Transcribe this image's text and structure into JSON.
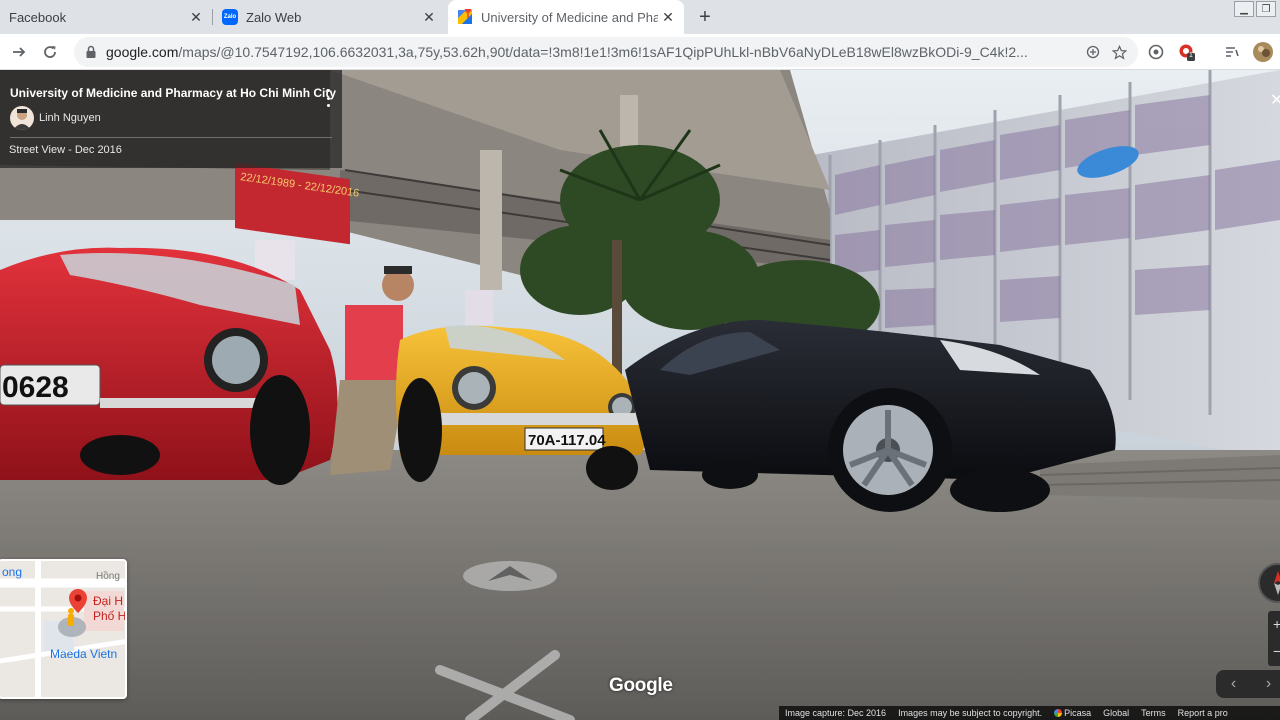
{
  "browser": {
    "tabs": [
      {
        "title": "Facebook",
        "active": false
      },
      {
        "title": "Zalo Web",
        "active": false,
        "favicon": "Zalo"
      },
      {
        "title": "University of Medicine and Pha",
        "active": true
      }
    ],
    "close_glyph": "✕",
    "new_tab_glyph": "+",
    "window_controls": {
      "minimize": "▁",
      "restore": "❐"
    },
    "url_host": "google.com",
    "url_path": "/maps/@10.7547192,106.6632031,3a,75y,53.62h,90t/data=!3m8!1e1!3m6!1sAF1QipPUhLkl-nBbV6aNyDLeB18wEl8wzBkODi-9_C4k!2...",
    "extension_badge": "1"
  },
  "streetview": {
    "place_title": "University of Medicine and Pharmacy at Ho Chi Minh City",
    "author": "Linh Nguyen",
    "capture_label": "Street View - Dec 2016",
    "logo": "Google",
    "zoom_in": "+",
    "zoom_out": "−",
    "nav_prev": "‹",
    "nav_next": "›",
    "close_glyph": "✕",
    "minimap": {
      "labels": [
        "ong",
        "Hồng",
        "Đại H",
        "Phố H",
        "Maeda Vietn"
      ]
    },
    "footer": {
      "capture": "Image capture: Dec 2016",
      "copyright": "Images may be subject to copyright.",
      "picasa": "Picasa",
      "global": "Global",
      "terms": "Terms",
      "report": "Report a pro"
    },
    "plates": {
      "red_car": "0628",
      "yellow_car": "70A-117.04"
    },
    "banner_text": "22/12/1989 - 22/12/2016"
  },
  "colors": {
    "tabstrip": "#dee1e6",
    "active_tab": "#ffffff",
    "omnibox": "#f1f3f4",
    "red_car": "#c8202c",
    "yellow_car": "#f0b41c",
    "black_car": "#15171c"
  }
}
